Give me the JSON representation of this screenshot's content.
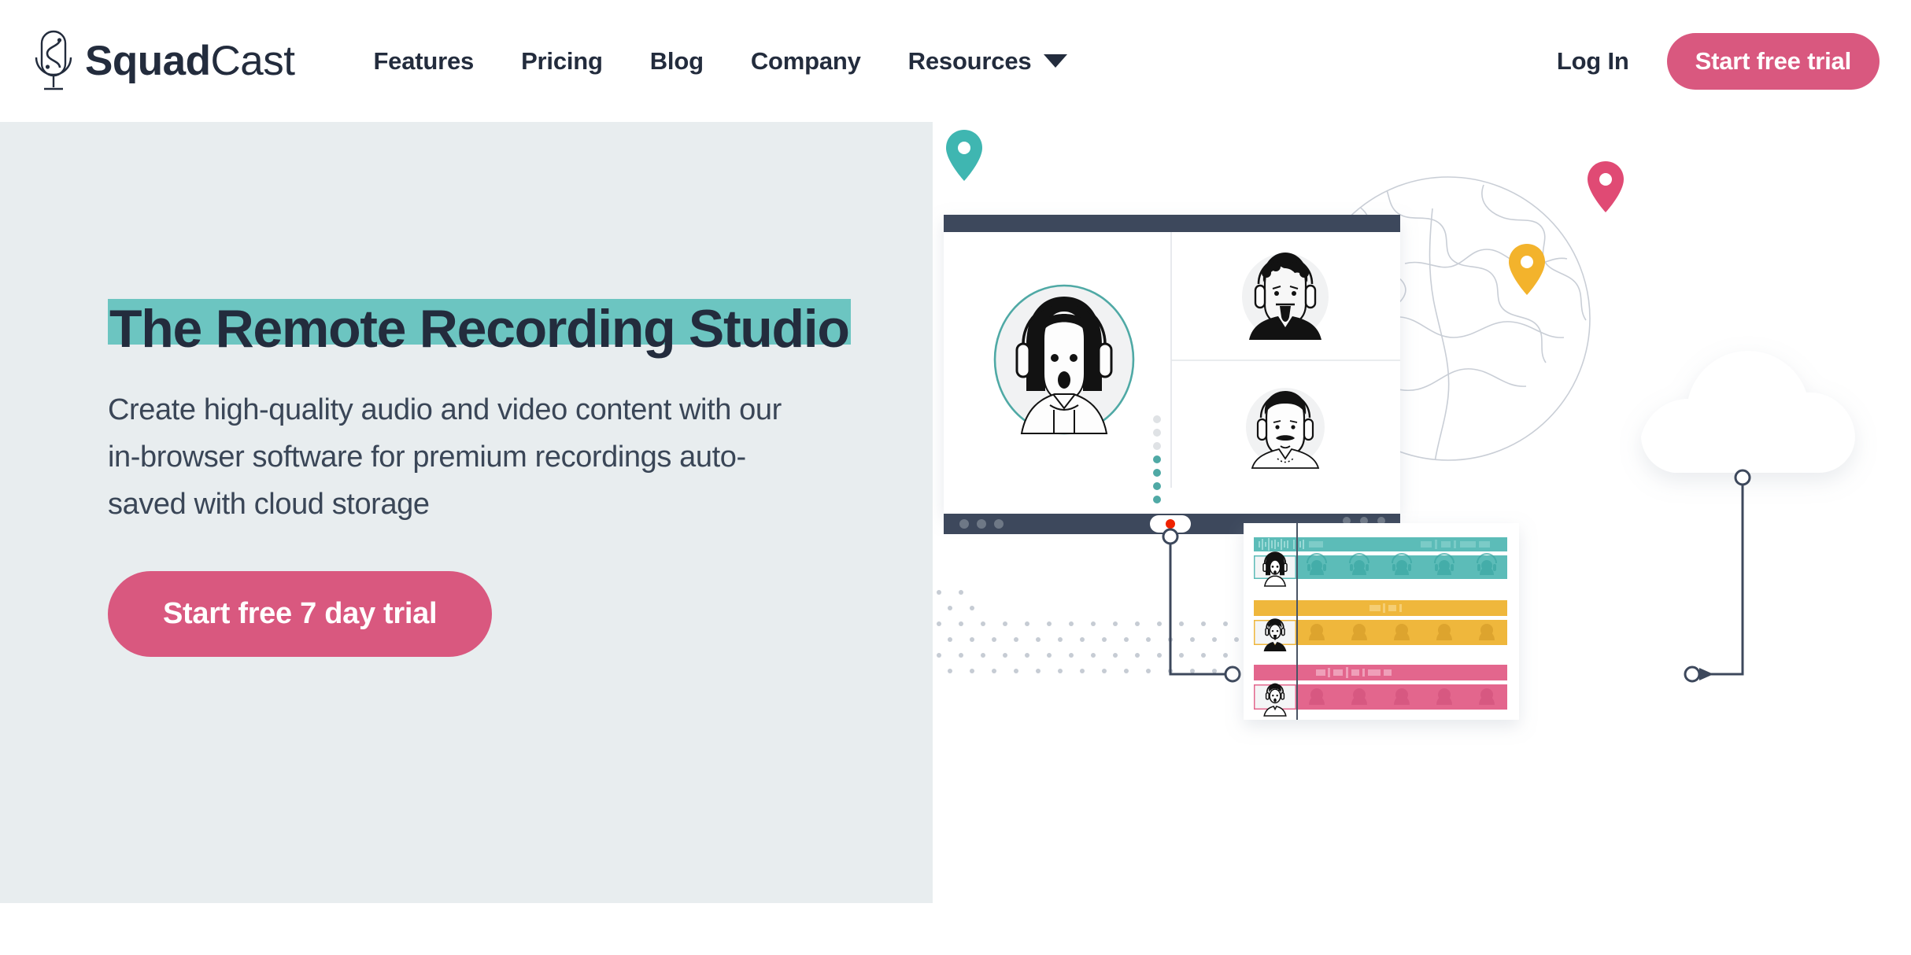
{
  "brand": {
    "name_bold": "Squad",
    "name_light": "Cast",
    "logo_icon": "microphone-s-logo"
  },
  "header": {
    "nav": [
      {
        "label": "Features",
        "has_dropdown": false
      },
      {
        "label": "Pricing",
        "has_dropdown": false
      },
      {
        "label": "Blog",
        "has_dropdown": false
      },
      {
        "label": "Company",
        "has_dropdown": false
      },
      {
        "label": "Resources",
        "has_dropdown": true
      }
    ],
    "login_label": "Log In",
    "trial_label": "Start free trial"
  },
  "hero": {
    "title": "The Remote Recording Studio",
    "subtitle": "Create high-quality audio and video content with our in-browser software for premium recordings auto-saved with cloud storage",
    "cta_label": "Start free 7 day trial"
  },
  "colors": {
    "accent_pink": "#d9587f",
    "highlight_teal": "#6cc5c1",
    "panel_bg": "#e8edef",
    "dark_navy": "#3d485c",
    "text_dark": "#232c3d",
    "track_teal": "#5cbcb8",
    "track_amber": "#efb73c",
    "track_pink": "#e3668d",
    "pin_teal": "#3fb6b1",
    "pin_pink": "#e04a74",
    "pin_yellow": "#f3b32c",
    "record_red": "#ef2200"
  },
  "illustration": {
    "name": "remote-recording-studio-illustration",
    "globe": {
      "name": "world-globe-outline",
      "pins": [
        "teal-pin",
        "pink-pin",
        "yellow-pin"
      ]
    },
    "cloud": {
      "name": "cloud-storage-shape"
    },
    "call_window": {
      "name": "video-call-window",
      "participants": [
        {
          "name": "participant-main-woman-headphones",
          "position": "main"
        },
        {
          "name": "participant-man-curly-beard-headphones",
          "position": "top-right"
        },
        {
          "name": "participant-man-mustache-headphones",
          "position": "bottom-right"
        }
      ],
      "record_button": "record-button",
      "window_dots": 3,
      "level_dots": {
        "total": 7,
        "active": 4
      }
    },
    "timeline": {
      "name": "multitrack-timeline-panel",
      "playhead": "playhead-line",
      "tracks": [
        {
          "name": "track-teal",
          "color": "#5cbcb8",
          "waveform": true,
          "thumbnails": 6
        },
        {
          "name": "track-amber",
          "color": "#efb73c",
          "waveform": true,
          "thumbnails": 6
        },
        {
          "name": "track-pink",
          "color": "#e3668d",
          "waveform": true,
          "thumbnails": 6
        }
      ]
    },
    "connectors": [
      "record-to-timeline-connector",
      "cloud-to-timeline-connector"
    ],
    "dot_grid": "decorative-dot-grid"
  }
}
